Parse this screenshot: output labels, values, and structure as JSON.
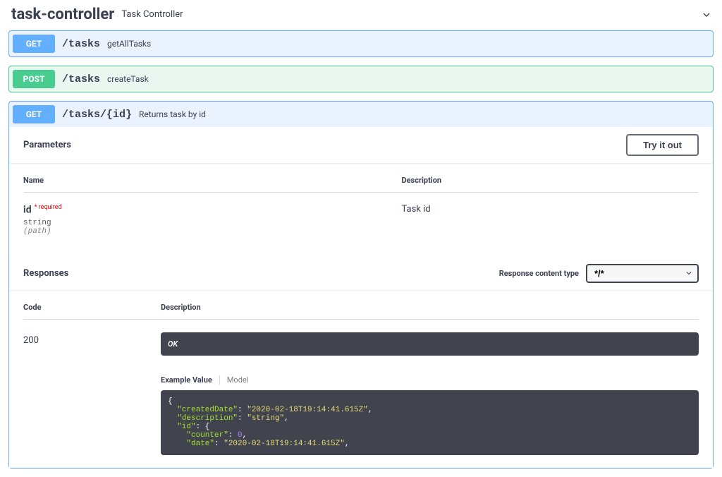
{
  "tag": {
    "name": "task-controller",
    "description": "Task Controller"
  },
  "operations": [
    {
      "method": "GET",
      "path": "/tasks",
      "summary": "getAllTasks"
    },
    {
      "method": "POST",
      "path": "/tasks",
      "summary": "createTask"
    },
    {
      "method": "GET",
      "path": "/tasks/{id}",
      "summary": "Returns task by id"
    }
  ],
  "expanded": {
    "paramsTitle": "Parameters",
    "tryItOutLabel": "Try it out",
    "paramHeaders": {
      "name": "Name",
      "desc": "Description"
    },
    "params": [
      {
        "name": "id",
        "requiredLabel": "required",
        "type": "string",
        "in": "(path)",
        "description": "Task id"
      }
    ],
    "responsesTitle": "Responses",
    "contentTypeLabel": "Response content type",
    "contentTypeValue": "*/*",
    "respHeaders": {
      "code": "Code",
      "desc": "Description"
    },
    "tabs": {
      "example": "Example Value",
      "model": "Model"
    },
    "responses": [
      {
        "code": "200",
        "message": "OK",
        "example": "{\n  \"createdDate\": \"2020-02-18T19:14:41.615Z\",\n  \"description\": \"string\",\n  \"id\": {\n    \"counter\": 0,\n    \"date\": \"2020-02-18T19:14:41.615Z\","
      }
    ]
  }
}
